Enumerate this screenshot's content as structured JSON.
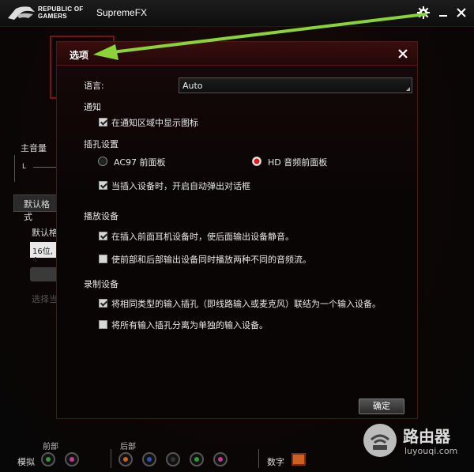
{
  "titlebar": {
    "brand_line1": "REPUBLIC OF",
    "brand_line2": "GAMERS",
    "app_title": "SupremeFX"
  },
  "main": {
    "master_volume_label": "主音量",
    "channel_L": "L",
    "default_format_tab": "默认格式",
    "default_format_label": "默认格",
    "format_value": "16位, 4",
    "select_hint": "选择当"
  },
  "bottom": {
    "front_label": "前部",
    "rear_label": "后部",
    "analog_label": "模拟",
    "digital_label": "数字",
    "front_jacks": [
      "#2e9a3a",
      "#c03a90"
    ],
    "rear_jacks": [
      "#d06020",
      "#2a50c0",
      "#333333",
      "#2e9a3a",
      "#c03a90"
    ]
  },
  "dialog": {
    "title": "选项",
    "language_label": "语言:",
    "language_value": "Auto",
    "notify_section": "通知",
    "notify_tray_icon": {
      "label": "在通知区域中显示图标",
      "checked": true
    },
    "jack_section": "插孔设置",
    "radio_ac97": {
      "label": "AC97 前面板",
      "selected": false
    },
    "radio_hd": {
      "label": "HD 音频前面板",
      "selected": true
    },
    "auto_popup": {
      "label": "当插入设备时，开启自动弹出对话框",
      "checked": true
    },
    "playback_section": "播放设备",
    "mute_rear": {
      "label": "在插入前面耳机设备时，使后面输出设备静音。",
      "checked": true
    },
    "dual_stream": {
      "label": "使前部和后部输出设备同时播放两种不同的音频流。",
      "checked": false
    },
    "record_section": "录制设备",
    "merge_inputs": {
      "label": "将相同类型的输入插孔（即线路输入或麦克风）联结为一个输入设备。",
      "checked": true
    },
    "separate_inputs": {
      "label": "将所有输入插孔分离为单独的输入设备。",
      "checked": false
    },
    "ok_label": "确定"
  },
  "watermark": {
    "text": "路由器",
    "url": "luyouqi.com"
  },
  "colors": {
    "accent_red": "#d01010",
    "arrow_green": "#8ad43a"
  }
}
